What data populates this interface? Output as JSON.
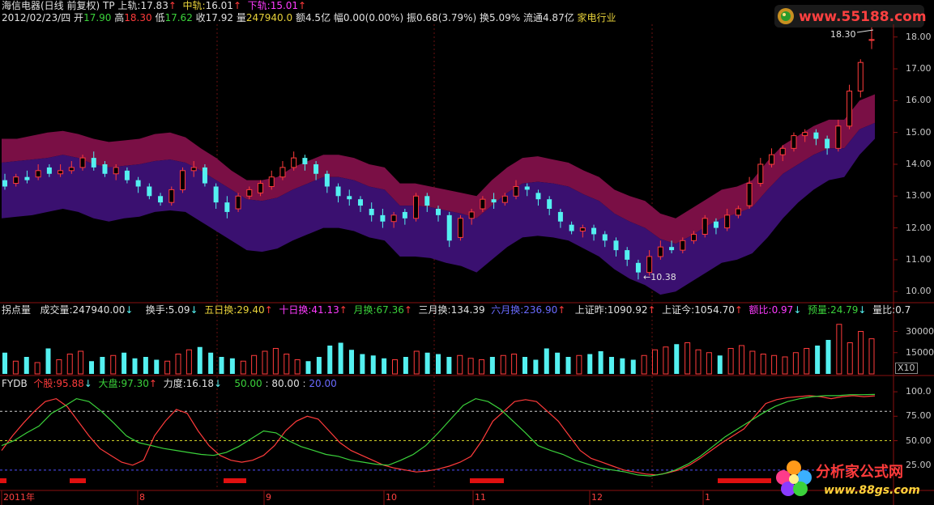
{
  "header": {
    "stock_name": "海信电器(日线 前复权)",
    "indicator": "TP",
    "upper_label": "上轨:",
    "upper_value": "17.83",
    "mid_label": "中轨:",
    "mid_value": "16.01",
    "lower_label": "下轨:",
    "lower_value": "15.01",
    "arrow": "↑"
  },
  "quote": {
    "date": "2012/02/23/四",
    "open_label": "开",
    "open": "17.90",
    "high_label": "高",
    "high": "18.30",
    "low_label": "低",
    "low": "17.62",
    "close_label": "收",
    "close": "17.92",
    "vol_label": "量",
    "vol": "247940.0",
    "amt_label": "额",
    "amt": "4.5亿",
    "chg_label": "幅",
    "chg": "0.00(0.00%)",
    "amp_label": "振",
    "amp": "0.68(3.79%)",
    "turn_label": "换",
    "turn": "5.09%",
    "float_label": "流通",
    "float": "4.87亿",
    "industry": "家电行业"
  },
  "price_axis": [
    "18.00",
    "17.00",
    "16.00",
    "15.00",
    "14.00",
    "13.00",
    "12.00",
    "11.00",
    "10.00"
  ],
  "price_annotations": {
    "high": "18.30",
    "low": "←10.38"
  },
  "volume_header": {
    "prefix": "拐点量",
    "vol_label": "成交量:",
    "vol": "247940.00",
    "turn_label": "换手:",
    "turn": "5.09",
    "d5_label": "五日换:",
    "d5": "29.40",
    "d10_label": "十日换:",
    "d10": "41.13",
    "m1_label": "月换:",
    "m1": "67.36",
    "m3_label": "三月换:",
    "m3": "134.39",
    "m6_label": "六月换:",
    "m6": "236.90",
    "szy_label": "上证昨:",
    "szy": "1090.92",
    "szt_label": "上证今:",
    "szt": "1054.70",
    "ratio_label": "额比:",
    "ratio": "0.97",
    "pred_label": "预量:",
    "pred": "24.79",
    "vr_label": "量比:",
    "vr": "0.7"
  },
  "volume_axis": [
    "30000",
    "15000"
  ],
  "volume_unit": "X10",
  "fydb": {
    "name": "FYDB",
    "stock_label": "个股:",
    "stock": "95.88",
    "market_label": "大盘:",
    "market": "97.30",
    "force_label": "力度:",
    "force": "16.18",
    "l1": "50.00",
    "l2": "80.00",
    "l3": "20.00"
  },
  "fydb_axis": [
    "100.0",
    "75.00",
    "50.00",
    "25.00"
  ],
  "months": [
    "2011年",
    "8",
    "9",
    "10",
    "11",
    "12",
    "1"
  ],
  "watermark_top": "www.55188.com",
  "watermark_bottom": {
    "title": "分析家公式网",
    "url": "www.88gs.com"
  },
  "colors": {
    "up": "#ff3b3b",
    "down": "#54f0f0",
    "band_upper": "#7a0f45",
    "band_lower": "#3a1070",
    "green_line": "#3bd23b"
  },
  "chart_data": [
    {
      "type": "candlestick",
      "title": "海信电器(日线 前复权)",
      "ylim": [
        9.7,
        18.4
      ],
      "x_months": [
        "2011年",
        "8",
        "9",
        "10",
        "11",
        "12",
        "1"
      ],
      "bands": {
        "upper_line": [
          14.8,
          14.8,
          14.9,
          15.0,
          15.05,
          14.95,
          14.8,
          14.7,
          14.75,
          14.8,
          14.95,
          15.0,
          14.85,
          14.5,
          14.2,
          13.8,
          13.5,
          13.5,
          13.6,
          13.9,
          14.1,
          14.3,
          14.3,
          14.2,
          14.0,
          13.9,
          13.4,
          13.4,
          13.3,
          13.2,
          13.1,
          13.0,
          13.5,
          13.9,
          14.2,
          14.25,
          14.15,
          14.05,
          13.8,
          13.6,
          13.2,
          13.0,
          12.85,
          12.45,
          12.3,
          12.6,
          12.9,
          13.2,
          13.3,
          13.5,
          14.1,
          14.6,
          14.9,
          15.2,
          15.4,
          15.4,
          16.0,
          16.2
        ],
        "mid_line": [
          14.05,
          14.1,
          14.15,
          14.2,
          14.3,
          14.2,
          14.0,
          13.9,
          13.95,
          14.0,
          14.1,
          14.15,
          14.05,
          13.8,
          13.5,
          13.2,
          12.9,
          12.85,
          12.95,
          13.2,
          13.4,
          13.6,
          13.6,
          13.5,
          13.3,
          13.2,
          12.7,
          12.7,
          12.65,
          12.55,
          12.45,
          12.3,
          12.7,
          13.1,
          13.4,
          13.45,
          13.4,
          13.3,
          13.05,
          12.85,
          12.45,
          12.2,
          12.0,
          11.65,
          11.5,
          11.75,
          12.05,
          12.3,
          12.45,
          12.65,
          13.2,
          13.7,
          14.0,
          14.3,
          14.5,
          14.5,
          15.1,
          15.3
        ],
        "lower_line": [
          12.3,
          12.35,
          12.4,
          12.5,
          12.6,
          12.5,
          12.3,
          12.2,
          12.3,
          12.35,
          12.5,
          12.55,
          12.5,
          12.2,
          11.9,
          11.6,
          11.3,
          11.25,
          11.35,
          11.6,
          11.8,
          12.0,
          12.0,
          11.9,
          11.7,
          11.6,
          11.1,
          11.1,
          11.05,
          10.9,
          10.8,
          10.6,
          11.0,
          11.4,
          11.7,
          11.75,
          11.7,
          11.6,
          11.35,
          11.1,
          10.7,
          10.4,
          10.2,
          9.9,
          10.0,
          10.3,
          10.6,
          10.9,
          11.0,
          11.2,
          11.7,
          12.3,
          12.8,
          13.2,
          13.5,
          13.6,
          14.3,
          14.8
        ]
      },
      "candles": [
        [
          13.5,
          13.3,
          13.7,
          13.2
        ],
        [
          13.4,
          13.6,
          13.7,
          13.3
        ],
        [
          13.6,
          13.5,
          13.8,
          13.4
        ],
        [
          13.6,
          13.8,
          14.0,
          13.5
        ],
        [
          13.9,
          13.7,
          14.0,
          13.6
        ],
        [
          13.7,
          13.8,
          14.0,
          13.6
        ],
        [
          13.8,
          13.9,
          14.1,
          13.7
        ],
        [
          13.9,
          14.2,
          14.3,
          13.8
        ],
        [
          14.2,
          13.9,
          14.4,
          13.8
        ],
        [
          14.0,
          13.7,
          14.1,
          13.6
        ],
        [
          13.7,
          13.9,
          14.0,
          13.5
        ],
        [
          13.8,
          13.5,
          13.9,
          13.4
        ],
        [
          13.5,
          13.3,
          13.6,
          13.1
        ],
        [
          13.3,
          13.0,
          13.4,
          12.9
        ],
        [
          13.0,
          12.8,
          13.1,
          12.7
        ],
        [
          12.8,
          13.2,
          13.3,
          12.7
        ],
        [
          13.2,
          13.8,
          13.9,
          13.1
        ],
        [
          13.8,
          13.9,
          14.1,
          13.6
        ],
        [
          13.9,
          13.4,
          14.0,
          13.3
        ],
        [
          13.3,
          12.8,
          13.4,
          12.6
        ],
        [
          12.8,
          12.5,
          13.0,
          12.3
        ],
        [
          12.6,
          13.0,
          13.1,
          12.5
        ],
        [
          13.0,
          13.2,
          13.3,
          12.9
        ],
        [
          13.1,
          13.4,
          13.5,
          13.0
        ],
        [
          13.3,
          13.6,
          13.8,
          13.2
        ],
        [
          13.6,
          13.9,
          14.1,
          13.5
        ],
        [
          13.9,
          14.2,
          14.4,
          13.8
        ],
        [
          14.2,
          14.0,
          14.3,
          13.8
        ],
        [
          14.0,
          13.7,
          14.1,
          13.5
        ],
        [
          13.7,
          13.3,
          13.8,
          13.1
        ],
        [
          13.3,
          13.0,
          13.4,
          12.8
        ],
        [
          13.0,
          12.9,
          13.2,
          12.7
        ],
        [
          12.9,
          12.7,
          13.0,
          12.5
        ],
        [
          12.6,
          12.4,
          12.8,
          12.2
        ],
        [
          12.4,
          12.2,
          12.6,
          12.0
        ],
        [
          12.2,
          12.4,
          12.5,
          12.0
        ],
        [
          12.5,
          12.3,
          12.6,
          12.1
        ],
        [
          12.3,
          13.0,
          13.1,
          12.2
        ],
        [
          13.0,
          12.7,
          13.1,
          12.5
        ],
        [
          12.6,
          12.4,
          12.7,
          12.2
        ],
        [
          12.4,
          11.6,
          12.5,
          11.4
        ],
        [
          11.7,
          12.3,
          12.4,
          11.6
        ],
        [
          12.3,
          12.5,
          12.6,
          12.1
        ],
        [
          12.6,
          12.9,
          13.0,
          12.5
        ],
        [
          12.9,
          12.8,
          13.1,
          12.6
        ],
        [
          12.8,
          13.0,
          13.1,
          12.7
        ],
        [
          13.0,
          13.3,
          13.5,
          12.9
        ],
        [
          13.3,
          13.2,
          13.4,
          13.0
        ],
        [
          13.1,
          12.9,
          13.2,
          12.7
        ],
        [
          12.9,
          12.6,
          13.0,
          12.4
        ],
        [
          12.5,
          12.2,
          12.6,
          12.0
        ],
        [
          12.1,
          11.9,
          12.2,
          11.8
        ],
        [
          11.9,
          12.0,
          12.1,
          11.7
        ],
        [
          12.0,
          11.8,
          12.1,
          11.6
        ],
        [
          11.8,
          11.6,
          11.9,
          11.4
        ],
        [
          11.6,
          11.3,
          11.7,
          11.1
        ],
        [
          11.3,
          11.0,
          11.4,
          10.8
        ],
        [
          10.9,
          10.6,
          11.0,
          10.38
        ],
        [
          10.6,
          11.1,
          11.3,
          10.5
        ],
        [
          11.1,
          11.4,
          11.6,
          11.0
        ],
        [
          11.4,
          11.3,
          11.6,
          11.2
        ],
        [
          11.3,
          11.6,
          11.7,
          11.2
        ],
        [
          11.6,
          11.8,
          11.9,
          11.5
        ],
        [
          11.8,
          12.3,
          12.4,
          11.7
        ],
        [
          12.2,
          12.0,
          12.3,
          11.8
        ],
        [
          12.0,
          12.4,
          12.6,
          11.9
        ],
        [
          12.4,
          12.6,
          12.7,
          12.3
        ],
        [
          12.7,
          13.4,
          13.6,
          12.6
        ],
        [
          13.4,
          14.0,
          14.2,
          13.3
        ],
        [
          14.0,
          14.3,
          14.5,
          13.9
        ],
        [
          14.3,
          14.5,
          14.6,
          14.1
        ],
        [
          14.5,
          14.9,
          15.0,
          14.4
        ],
        [
          14.9,
          15.0,
          15.1,
          14.7
        ],
        [
          15.0,
          14.8,
          15.1,
          14.6
        ],
        [
          14.8,
          14.5,
          14.9,
          14.3
        ],
        [
          14.5,
          15.2,
          15.4,
          14.4
        ],
        [
          15.2,
          16.3,
          16.5,
          15.1
        ],
        [
          16.3,
          17.2,
          17.3,
          16.1
        ],
        [
          17.9,
          17.92,
          18.3,
          17.62
        ]
      ]
    },
    {
      "type": "bar",
      "title": "拐点量",
      "ylim": [
        0,
        40000
      ],
      "ylabel": "X10",
      "values": [
        15000,
        9000,
        12000,
        8000,
        18000,
        10000,
        14000,
        16000,
        9000,
        12000,
        13000,
        15000,
        11000,
        12000,
        10000,
        9000,
        14000,
        17000,
        19000,
        15000,
        12000,
        11000,
        9000,
        13000,
        16000,
        18000,
        14000,
        10000,
        9000,
        12000,
        20000,
        22000,
        17000,
        14000,
        13000,
        11000,
        10000,
        12000,
        16000,
        15000,
        14000,
        12000,
        13000,
        11000,
        10000,
        12000,
        13000,
        14000,
        12000,
        10000,
        18000,
        15000,
        12000,
        13000,
        14000,
        16000,
        12000,
        11000,
        10000,
        13000,
        17000,
        19000,
        21000,
        22000,
        17000,
        15000,
        13000,
        18000,
        20000,
        16000,
        14000,
        13000,
        12000,
        15000,
        18000,
        20000,
        24000,
        35000,
        22000,
        30000,
        24800
      ]
    },
    {
      "type": "line",
      "title": "FYDB",
      "ylim": [
        0,
        110
      ],
      "series": [
        {
          "name": "个股",
          "values": [
            40,
            55,
            68,
            80,
            90,
            93,
            85,
            70,
            55,
            42,
            35,
            28,
            25,
            30,
            55,
            70,
            82,
            78,
            60,
            45,
            35,
            30,
            28,
            30,
            35,
            45,
            60,
            70,
            75,
            72,
            60,
            48,
            40,
            35,
            30,
            25,
            22,
            20,
            18,
            19,
            21,
            24,
            28,
            34,
            50,
            70,
            80,
            90,
            92,
            90,
            80,
            70,
            55,
            40,
            32,
            28,
            24,
            20,
            18,
            16,
            15,
            17,
            20,
            25,
            32,
            40,
            48,
            55,
            62,
            75,
            88,
            92,
            94,
            95,
            96,
            95,
            93,
            95,
            96,
            95,
            95.88
          ]
        },
        {
          "name": "大盘",
          "values": [
            45,
            50,
            58,
            65,
            78,
            85,
            93,
            90,
            80,
            68,
            55,
            48,
            45,
            42,
            40,
            38,
            36,
            35,
            38,
            44,
            52,
            60,
            58,
            50,
            44,
            40,
            36,
            34,
            30,
            28,
            26,
            25,
            30,
            36,
            45,
            58,
            72,
            86,
            93,
            90,
            82,
            70,
            58,
            45,
            40,
            36,
            30,
            26,
            22,
            20,
            18,
            15,
            14,
            16,
            20,
            26,
            34,
            44,
            54,
            62,
            70,
            78,
            85,
            90,
            93,
            95,
            96,
            96,
            97,
            97,
            97.3
          ]
        }
      ]
    }
  ]
}
